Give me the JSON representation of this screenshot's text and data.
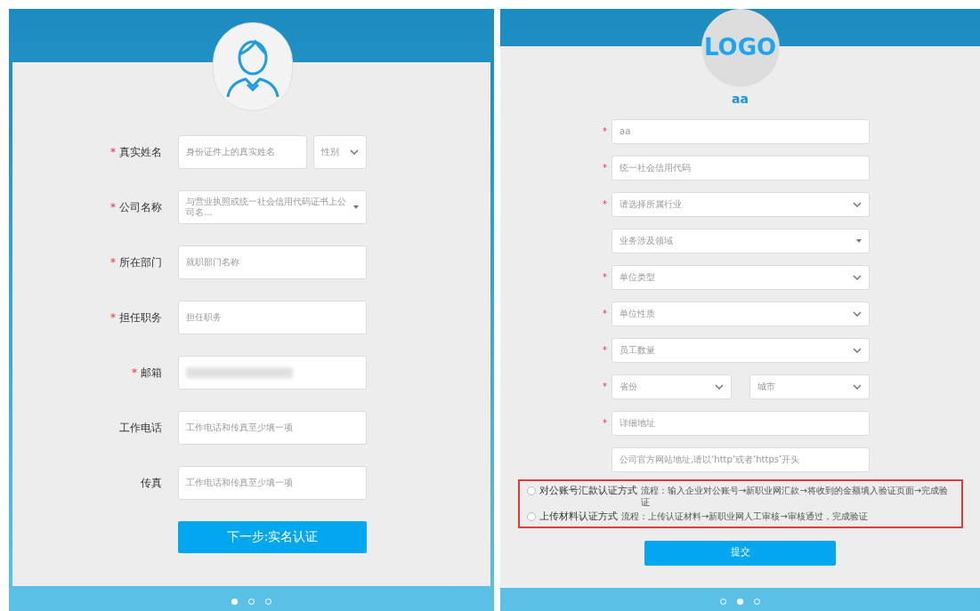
{
  "left": {
    "fields": [
      {
        "label": "真实姓名",
        "marker": "*",
        "kind": "name_gender",
        "placeholder": "身份证件上的真实姓名",
        "select": "性别"
      },
      {
        "label": "公司名称",
        "marker": "*",
        "kind": "combo",
        "placeholder": "与营业执照或统一社会信用代码证书上公司名..."
      },
      {
        "label": "所在部门",
        "marker": "*",
        "kind": "text",
        "placeholder": "就职部门名称"
      },
      {
        "label": "担任职务",
        "marker": "*",
        "kind": "text",
        "placeholder": "担任职务"
      },
      {
        "label": "邮箱",
        "marker": "*",
        "kind": "redacted"
      },
      {
        "label": "工作电话",
        "kind": "text",
        "placeholder": "工作电话和传真至少填一项"
      },
      {
        "label": "传真",
        "kind": "text",
        "placeholder": "工作电话和传真至少填一项"
      }
    ],
    "button": "下一步:实名认证",
    "pager": [
      {
        "selected": true
      },
      {
        "selected": false
      },
      {
        "selected": false
      }
    ]
  },
  "right": {
    "logo": "LOGO",
    "company": "aa",
    "fields": [
      {
        "marker": "*",
        "kind": "text",
        "value": "aa"
      },
      {
        "marker": "*",
        "kind": "text",
        "placeholder": "统一社会信用代码"
      },
      {
        "marker": "*",
        "kind": "select",
        "placeholder": "请选择所属行业"
      },
      {
        "kind": "combo",
        "placeholder": "业务涉及领域"
      },
      {
        "marker": "*",
        "kind": "select",
        "placeholder": "单位类型"
      },
      {
        "marker": "*",
        "kind": "select",
        "placeholder": "单位性质"
      },
      {
        "marker": "*",
        "kind": "select",
        "placeholder": "员工数量"
      },
      {
        "marker": "*",
        "kind": "pair",
        "placeholder": "省份",
        "second": "城市"
      },
      {
        "marker": "*",
        "kind": "text",
        "placeholder": "详细地址"
      },
      {
        "kind": "text",
        "placeholder": "公司官方网站地址,请以‘http’或者‘https’开头"
      }
    ],
    "verification": [
      {
        "title": "对公账号汇款认证方式",
        "description": "流程：输入企业对公账号→新职业网汇款→将收到的金额填入验证页面→完成验证",
        "selected": false
      },
      {
        "title": "上传材料认证方式",
        "description": "流程：上传认证材料→新职业网人工审核→审核通过，完成验证",
        "selected": false
      }
    ],
    "submit": "提交",
    "pager": [
      {
        "selected": false
      },
      {
        "selected": true
      },
      {
        "selected": false
      }
    ]
  }
}
